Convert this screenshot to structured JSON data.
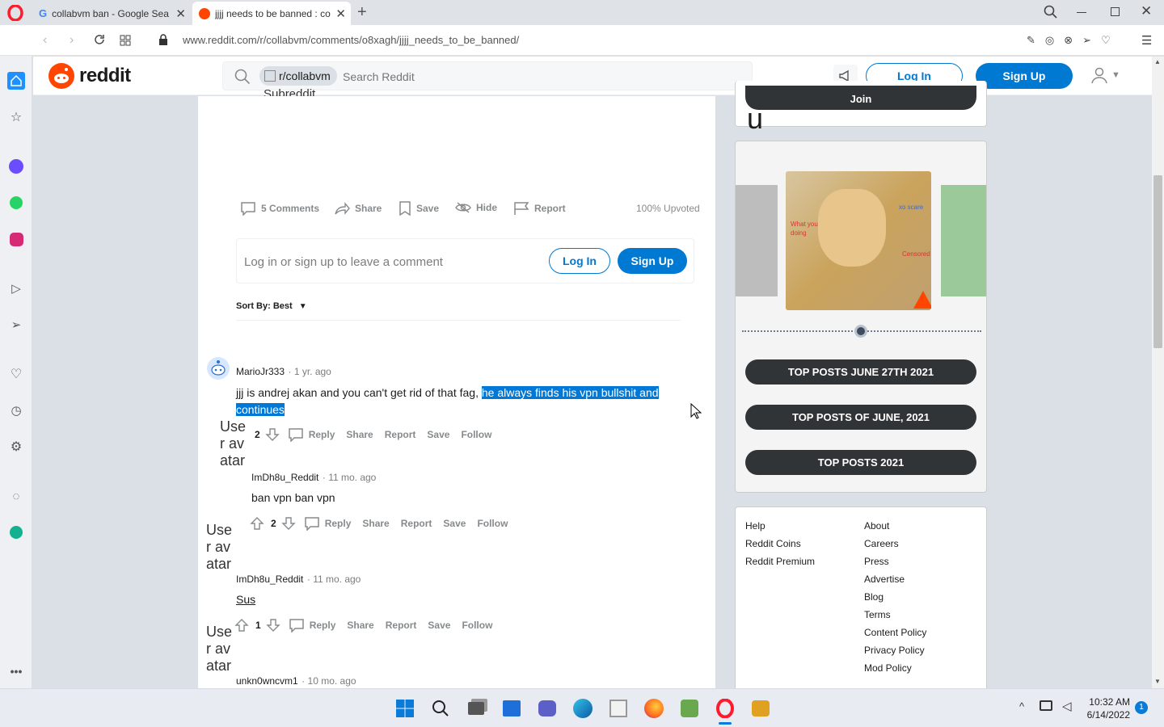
{
  "browser": {
    "tabs": [
      {
        "title": "collabvm ban - Google Sea",
        "active": false
      },
      {
        "title": "jjjj needs to be banned : co",
        "active": true
      }
    ],
    "url": "www.reddit.com/r/collabvm/comments/o8xagh/jjjj_needs_to_be_banned/"
  },
  "reddit": {
    "logo_text": "reddit",
    "search": {
      "community_chip": "r/collabvm",
      "placeholder": "Search Reddit",
      "broken_icon_text": "Subreddit Icon"
    },
    "login_label": "Log In",
    "signup_label": "Sign Up"
  },
  "post": {
    "actions": {
      "comments": "5 Comments",
      "share": "Share",
      "save": "Save",
      "hide": "Hide",
      "report": "Report"
    },
    "upvoted": "100% Upvoted",
    "comment_prompt": "Log in or sign up to leave a comment",
    "login_label": "Log In",
    "signup_label": "Sign Up",
    "sort_label": "Sort By: Best"
  },
  "comments": [
    {
      "author": "MarioJr333",
      "time": "1 yr. ago",
      "text_plain": "jjj is andrej akan and you can't get rid of that fag, ",
      "text_selected_1": "he always finds his vpn bullshit and",
      "text_selected_2": "continues",
      "votes": "2"
    },
    {
      "author": "ImDh8u_Reddit",
      "time": "11 mo. ago",
      "text": "ban vpn ban vpn",
      "votes": "2"
    },
    {
      "author": "ImDh8u_Reddit",
      "time": "11 mo. ago",
      "text": "Sus",
      "votes": "1"
    },
    {
      "author": "unkn0wncvm1",
      "time": "10 mo. ago"
    }
  ],
  "comment_actions": {
    "reply": "Reply",
    "share": "Share",
    "report": "Report",
    "save": "Save",
    "follow": "Follow"
  },
  "broken_avatar_text": "User avatar",
  "sidebar": {
    "join_label": "Join",
    "top_posts": [
      "TOP POSTS JUNE 27TH 2021",
      "TOP POSTS OF JUNE, 2021",
      "TOP POSTS 2021"
    ],
    "meme_text": [
      "What you doing",
      "xo scare",
      "Censored"
    ],
    "footer_left": [
      "Help",
      "Reddit Coins",
      "Reddit Premium"
    ],
    "footer_right": [
      "About",
      "Careers",
      "Press",
      "Advertise",
      "Blog",
      "Terms",
      "Content Policy",
      "Privacy Policy",
      "Mod Policy"
    ]
  },
  "taskbar": {
    "time": "10:32 AM",
    "date": "6/14/2022",
    "notification_count": "1"
  },
  "colors": {
    "reddit_orange": "#ff4500",
    "reddit_blue": "#0079d3",
    "selection": "#0078d7",
    "opera_red": "#ff1b2d"
  }
}
